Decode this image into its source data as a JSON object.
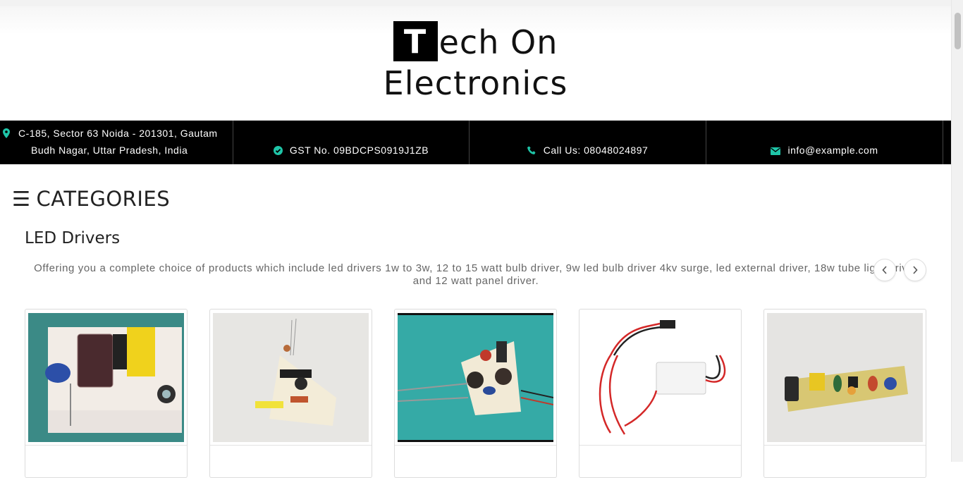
{
  "logo": {
    "first_letter": "T",
    "line1_rest": "ech On",
    "line2": "Electronics"
  },
  "infobar": {
    "address_line1": "C-185, Sector 63 Noida - 201301, Gautam",
    "address_line2": "Budh Nagar, Uttar Pradesh, India",
    "gst": "GST No. 09BDCPS0919J1ZB",
    "call": "Call Us: 08048024897",
    "email": "info@example.com",
    "icon_color": "#1fc5a8"
  },
  "categories": {
    "menu_icon": "☰",
    "label": "CATEGORIES"
  },
  "section": {
    "title": "LED Drivers",
    "description": "Offering you a complete choice of products which include led drivers 1w to 3w, 12 to 15 watt bulb driver, 9w led bulb driver 4kv surge, led external driver, 18w tube light driver and 12 watt panel driver."
  },
  "carousel": {
    "prev_icon": "‹",
    "next_icon": "›"
  },
  "products": [
    {
      "image": "led-driver-1w-3w-photo"
    },
    {
      "image": "bulb-driver-12-15w-photo"
    },
    {
      "image": "9w-bulb-driver-photo"
    },
    {
      "image": "led-external-driver-photo"
    },
    {
      "image": "18w-tube-light-driver-photo"
    }
  ]
}
